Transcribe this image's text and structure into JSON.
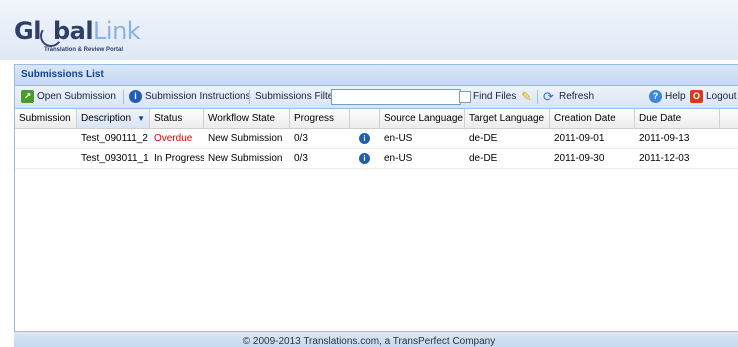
{
  "logo": {
    "text_part1": "Gl",
    "text_part2": "bal",
    "text_part3": "Link",
    "tagline": "Translation & Review Portal"
  },
  "panel": {
    "title": "Submissions List"
  },
  "toolbar": {
    "open_submission": "Open Submission",
    "submission_instructions": "Submission Instructions",
    "filter_label": "Submissions Filter",
    "filter_value": "",
    "find_files": "Find Files",
    "refresh": "Refresh",
    "help": "Help",
    "logout": "Logout"
  },
  "grid": {
    "columns": [
      "Submission",
      "Description",
      "Status",
      "Workflow State",
      "Progress",
      "",
      "Source Language",
      "Target Language",
      "Creation Date",
      "Due Date"
    ],
    "rows": [
      {
        "submission": "",
        "description": "Test_090111_2",
        "status": "Overdue",
        "workflow": "New Submission",
        "progress": "0/3",
        "source": "en-US",
        "target": "de-DE",
        "created": "2011-09-01",
        "due": "2011-09-13"
      },
      {
        "submission": "",
        "description": "Test_093011_1",
        "status": "In Progress",
        "workflow": "New Submission",
        "progress": "0/3",
        "source": "en-US",
        "target": "de-DE",
        "created": "2011-09-30",
        "due": "2011-12-03"
      }
    ]
  },
  "colors": {
    "overdue": "#e60000",
    "accent": "#15428b"
  },
  "footer": {
    "copyright": "© 2009-2013 Translations.com, a TransPerfect Company"
  }
}
